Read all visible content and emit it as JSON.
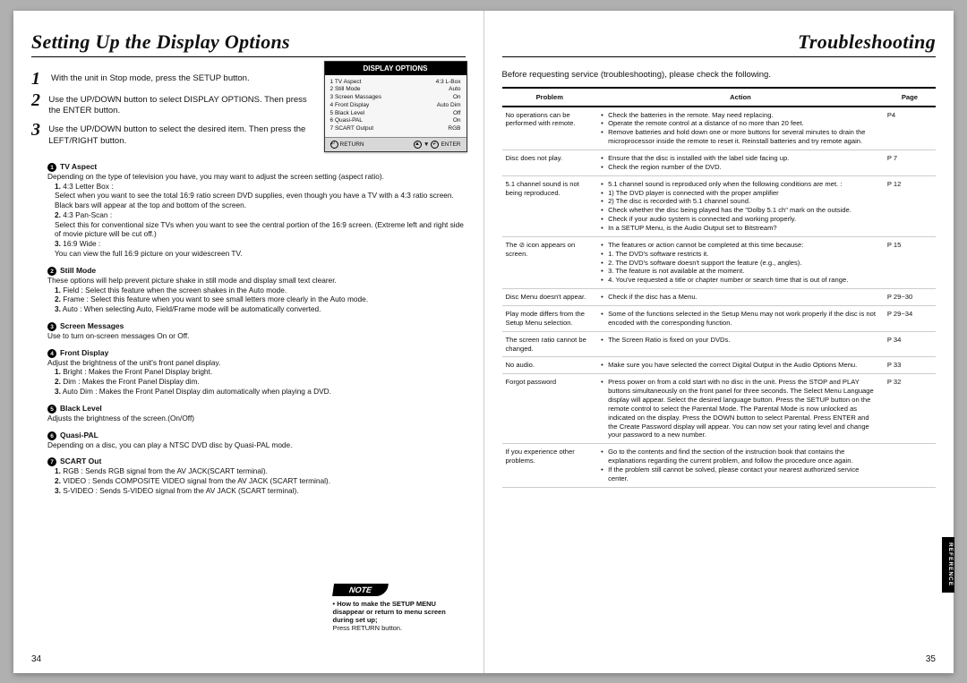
{
  "left": {
    "title": "Setting Up the Display Options",
    "steps": [
      {
        "n": "1",
        "text": "With the unit in Stop mode, press the SETUP button."
      },
      {
        "n": "2",
        "text": "Use the UP/DOWN button to select DISPLAY OPTIONS. Then press the ENTER button."
      },
      {
        "n": "3",
        "text": "Use the UP/DOWN button to select the desired item. Then press the LEFT/RIGHT button."
      }
    ],
    "osd": {
      "title": "DISPLAY OPTIONS",
      "rows": [
        {
          "n": "1",
          "label": "TV Aspect",
          "val": "4:3 L-Box"
        },
        {
          "n": "2",
          "label": "Still Mode",
          "val": "Auto"
        },
        {
          "n": "3",
          "label": "Screen Massages",
          "val": "On"
        },
        {
          "n": "4",
          "label": "Front Display",
          "val": "Auto Dim"
        },
        {
          "n": "5",
          "label": "Black Level",
          "val": "Off"
        },
        {
          "n": "6",
          "label": "Quasi-PAL",
          "val": "On"
        },
        {
          "n": "7",
          "label": "SCART Output",
          "val": "RGB"
        }
      ],
      "foot": {
        "return": "RETURN",
        "enter": "ENTER"
      }
    },
    "sections": [
      {
        "num": "1",
        "head": "TV Aspect",
        "intro": "Depending on the type of television you have, you may want to adjust the screen setting (aspect ratio).",
        "items": [
          {
            "n": "1.",
            "head": "4:3 Letter Box :",
            "body": "Select when you want to see the total 16:9 ratio screen DVD supplies, even though you have a TV with a 4:3 ratio screen. Black bars will appear at the top and bottom of the screen."
          },
          {
            "n": "2.",
            "head": "4:3 Pan-Scan :",
            "body": "Select this for conventional size TVs when you want to see the central portion of the 16:9 screen. (Extreme left and right side of movie picture will be cut off.)"
          },
          {
            "n": "3.",
            "head": "16:9 Wide :",
            "body": "You can view the full 16:9 picture on your widescreen TV."
          }
        ]
      },
      {
        "num": "2",
        "head": "Still Mode",
        "intro": "These options will help prevent picture shake in still mode and display small text clearer.",
        "items": [
          {
            "n": "1.",
            "head": "",
            "body": "Field : Select this feature when the screen shakes in the Auto mode."
          },
          {
            "n": "2.",
            "head": "",
            "body": "Frame : Select this feature when you want to see small letters more clearly in the Auto mode."
          },
          {
            "n": "3.",
            "head": "",
            "body": "Auto : When selecting Auto, Field/Frame mode will be automatically converted."
          }
        ]
      },
      {
        "num": "3",
        "head": "Screen Messages",
        "intro": "Use to turn on-screen messages On or Off.",
        "items": []
      },
      {
        "num": "4",
        "head": "Front Display",
        "intro": "Adjust the brightness of the unit's front panel display.",
        "items": [
          {
            "n": "1.",
            "head": "",
            "body": "Bright : Makes the Front Panel Display bright."
          },
          {
            "n": "2.",
            "head": "",
            "body": "Dim : Makes the Front Panel Display dim."
          },
          {
            "n": "3.",
            "head": "",
            "body": "Auto Dim : Makes the Front Panel Display dim automatically when playing a DVD."
          }
        ]
      },
      {
        "num": "5",
        "head": "Black Level",
        "intro": "Adjusts the brightness of the screen.(On/Off)",
        "items": []
      },
      {
        "num": "6",
        "head": "Quasi-PAL",
        "intro": "Depending on a disc, you can play a NTSC DVD disc by Quasi-PAL mode.",
        "items": []
      },
      {
        "num": "7",
        "head": "SCART Out",
        "intro": "",
        "items": [
          {
            "n": "1.",
            "head": "",
            "body": "RGB : Sends RGB signal from the AV JACK(SCART terminal)."
          },
          {
            "n": "2.",
            "head": "",
            "body": "VIDEO : Sends COMPOSITE VIDEO signal from the AV JACK (SCART terminal)."
          },
          {
            "n": "3.",
            "head": "",
            "body": "S-VIDEO : Sends S-VIDEO signal from the AV JACK (SCART terminal)."
          }
        ]
      }
    ],
    "note": {
      "label": "NOTE",
      "head": "How to make the SETUP MENU disappear or return to menu screen during set up;",
      "body": "Press RETURN button."
    },
    "pagenum": "34"
  },
  "right": {
    "title": "Troubleshooting",
    "intro": "Before requesting service (troubleshooting), please check the following.",
    "th": {
      "problem": "Problem",
      "action": "Action",
      "page": "Page"
    },
    "rows": [
      {
        "problem": "No operations can be performed with remote.",
        "actions": [
          "Check the batteries in the remote. May need replacing.",
          "Operate the remote control at a distance of no more than 20 feet.",
          "Remove batteries and hold down one or more buttons for several minutes to drain the microprocessor inside the remote to reset it. Reinstall batteries and try remote again."
        ],
        "page": "P4"
      },
      {
        "problem": "Disc does not play.",
        "actions": [
          "Ensure that the disc is installed with the label side facing up.",
          "Check the region number of the DVD."
        ],
        "page": "P 7"
      },
      {
        "problem": "5.1 channel sound is not being reproduced.",
        "actions": [
          "5.1 channel sound is reproduced only when the following conditions are met. :",
          "1) The DVD player is connected with the proper amplifier",
          "2) The disc is recorded with 5.1 channel sound.",
          "Check whether the disc being played has the \"Dolby 5.1 ch\" mark on the outside.",
          "Check if your audio system is connected and working properly.",
          "In a SETUP Menu, is the Audio Output set to Bitstream?"
        ],
        "page": "P 12"
      },
      {
        "problem": "The ⊘ icon appears on screen.",
        "actions": [
          "The features or action cannot be completed at this time because:",
          "1. The DVD's software restricts it.",
          "2. The DVD's software doesn't support the feature (e.g., angles).",
          "3. The feature is not available at the moment.",
          "4. You've requested a title or chapter number or search time that is out of range."
        ],
        "page": "P 15"
      },
      {
        "problem": "Disc Menu doesn't appear.",
        "actions": [
          "Check if the disc has a Menu."
        ],
        "page": "P 29~30"
      },
      {
        "problem": "Play mode differs from the Setup Menu selection.",
        "actions": [
          "Some of the functions selected in the Setup Menu may not work properly if the disc is not encoded with the corresponding function."
        ],
        "page": "P 29~34"
      },
      {
        "problem": "The screen ratio cannot be changed.",
        "actions": [
          "The Screen Ratio is fixed on your DVDs."
        ],
        "page": "P 34"
      },
      {
        "problem": "No audio.",
        "actions": [
          "Make sure you have selected the correct Digital Output in the Audio Options Menu."
        ],
        "page": "P 33"
      },
      {
        "problem": "Forgot password",
        "actions": [
          "Press power on from a cold start with no disc in the unit. Press the STOP and PLAY buttons simultaneously on the front panel for three seconds. The Select Menu Language display will appear. Select the desired language button. Press the SETUP button on the remote control to select the Parental Mode. The Parental Mode is now unlocked as indicated on the display. Press the DOWN button to select Parental. Press ENTER and the Create Password display will appear. You can now set your rating level and change your password to a new number."
        ],
        "page": "P 32"
      },
      {
        "problem": "If you experience other problems.",
        "actions": [
          "Go to the contents and find the section of the instruction book that contains the explanations regarding the current problem, and follow the procedure once again.",
          "If the problem still cannot be solved, please contact your nearest authorized service center."
        ],
        "page": ""
      }
    ],
    "sideTab": "REFERENCE",
    "pagenum": "35"
  }
}
